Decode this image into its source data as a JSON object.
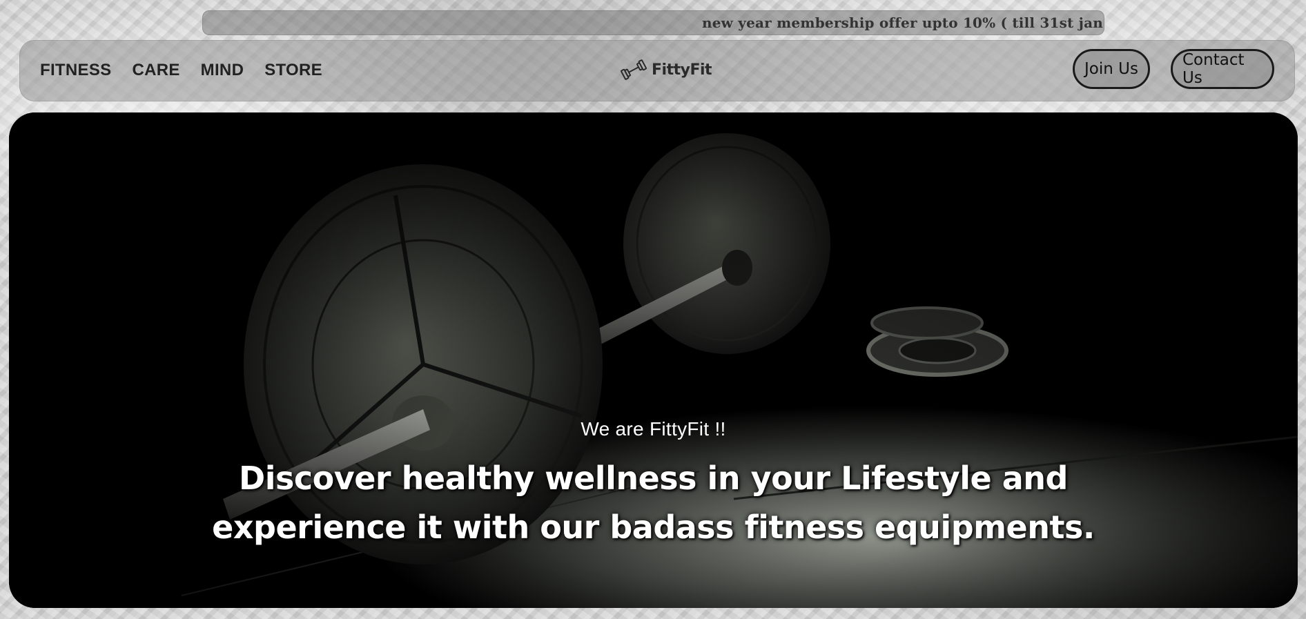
{
  "announcement": {
    "text": "new year membership offer upto 10% ( till 31st jan"
  },
  "nav": {
    "links": [
      {
        "label": "FITNESS"
      },
      {
        "label": "CARE"
      },
      {
        "label": "MIND"
      },
      {
        "label": "STORE"
      }
    ],
    "brand": {
      "name": "FittyFit",
      "icon": "dumbbell-icon"
    },
    "buttons": {
      "join": "Join Us",
      "contact": "Contact Us"
    }
  },
  "hero": {
    "eyebrow": "We are FittyFit !!",
    "headline_line1": "Discover healthy wellness in your Lifestyle and",
    "headline_line2": "experience it with our badass fitness equipments.",
    "image": "barbell-photo"
  },
  "colors": {
    "page_background": "#d3d3d3",
    "nav_text": "#222222",
    "hero_text": "#ffffff",
    "button_border": "#1a1a1a"
  }
}
